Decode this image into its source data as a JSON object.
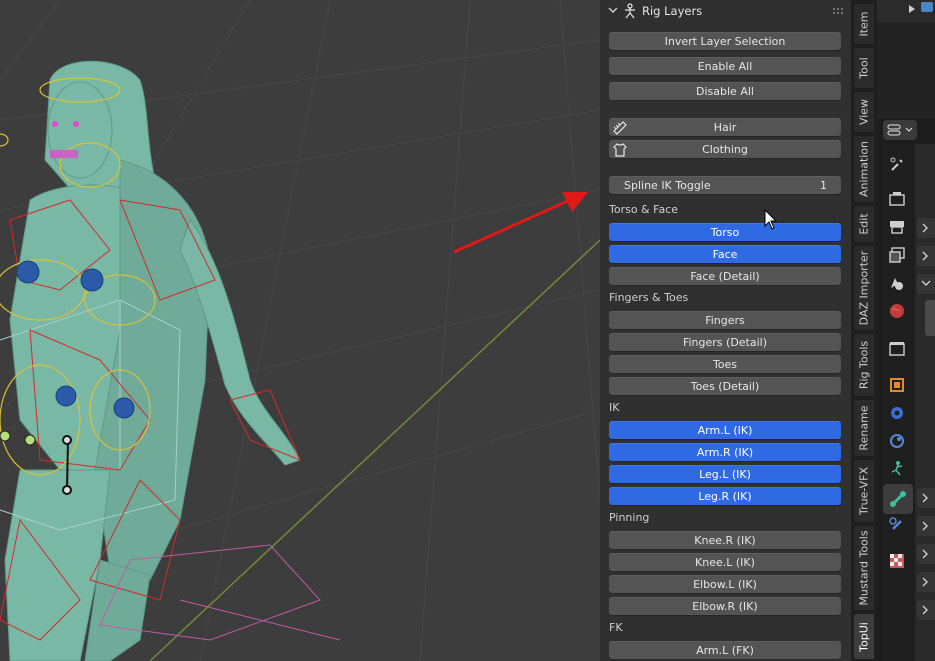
{
  "panel": {
    "title": "Rig Layers",
    "buttons_top": [
      "Invert Layer Selection",
      "Enable All",
      "Disable All"
    ],
    "hair_label": "Hair",
    "clothing_label": "Clothing",
    "spline_ik": {
      "label": "Spline IK Toggle",
      "value": "1"
    }
  },
  "sections": {
    "torso_face": {
      "heading": "Torso & Face",
      "items": [
        {
          "label": "Torso",
          "active": true
        },
        {
          "label": "Face",
          "active": true
        },
        {
          "label": "Face (Detail)",
          "active": false
        }
      ]
    },
    "fingers_toes": {
      "heading": "Fingers & Toes",
      "items": [
        {
          "label": "Fingers",
          "active": false
        },
        {
          "label": "Fingers (Detail)",
          "active": false
        },
        {
          "label": "Toes",
          "active": false
        },
        {
          "label": "Toes (Detail)",
          "active": false
        }
      ]
    },
    "ik": {
      "heading": "IK",
      "items": [
        {
          "label": "Arm.L (IK)",
          "active": true
        },
        {
          "label": "Arm.R (IK)",
          "active": true
        },
        {
          "label": "Leg.L (IK)",
          "active": true
        },
        {
          "label": "Leg.R (IK)",
          "active": true
        }
      ]
    },
    "pinning": {
      "heading": "Pinning",
      "items": [
        {
          "label": "Knee.R (IK)",
          "active": false
        },
        {
          "label": "Knee.L (IK)",
          "active": false
        },
        {
          "label": "Elbow.L (IK)",
          "active": false
        },
        {
          "label": "Elbow.R (IK)",
          "active": false
        }
      ]
    },
    "fk": {
      "heading": "FK",
      "items": [
        {
          "label": "Arm.L (FK)",
          "active": false
        }
      ]
    }
  },
  "tabs": [
    "Item",
    "Tool",
    "View",
    "Animation",
    "Edit",
    "DAZ Importer",
    "Rig Tools",
    "Rename",
    "True-VFX",
    "Mustard Tools",
    "TopUi"
  ],
  "active_tab": "TopUi",
  "colors": {
    "viewport_bg": "#3d3d3d",
    "panel_bg": "#303030",
    "button": "#545454",
    "button_active": "#2f6ae2",
    "mesh": "#79b8a5",
    "annotation_arrow": "#e01818"
  },
  "icons": {
    "header": [
      "chevron-down-icon",
      "armature-rig-icon",
      "drag-handle-icon"
    ],
    "hair": "comb-icon",
    "clothing": "shirt-icon",
    "properties": [
      "tool-icon",
      "render-icon",
      "output-icon",
      "view-layer-icon",
      "scene-icon",
      "world-icon",
      "collection-icon",
      "object-icon",
      "modifier-icon",
      "particles-icon",
      "physics-icon",
      "bone-icon",
      "bone-constraint-icon",
      "texture-icon"
    ]
  }
}
